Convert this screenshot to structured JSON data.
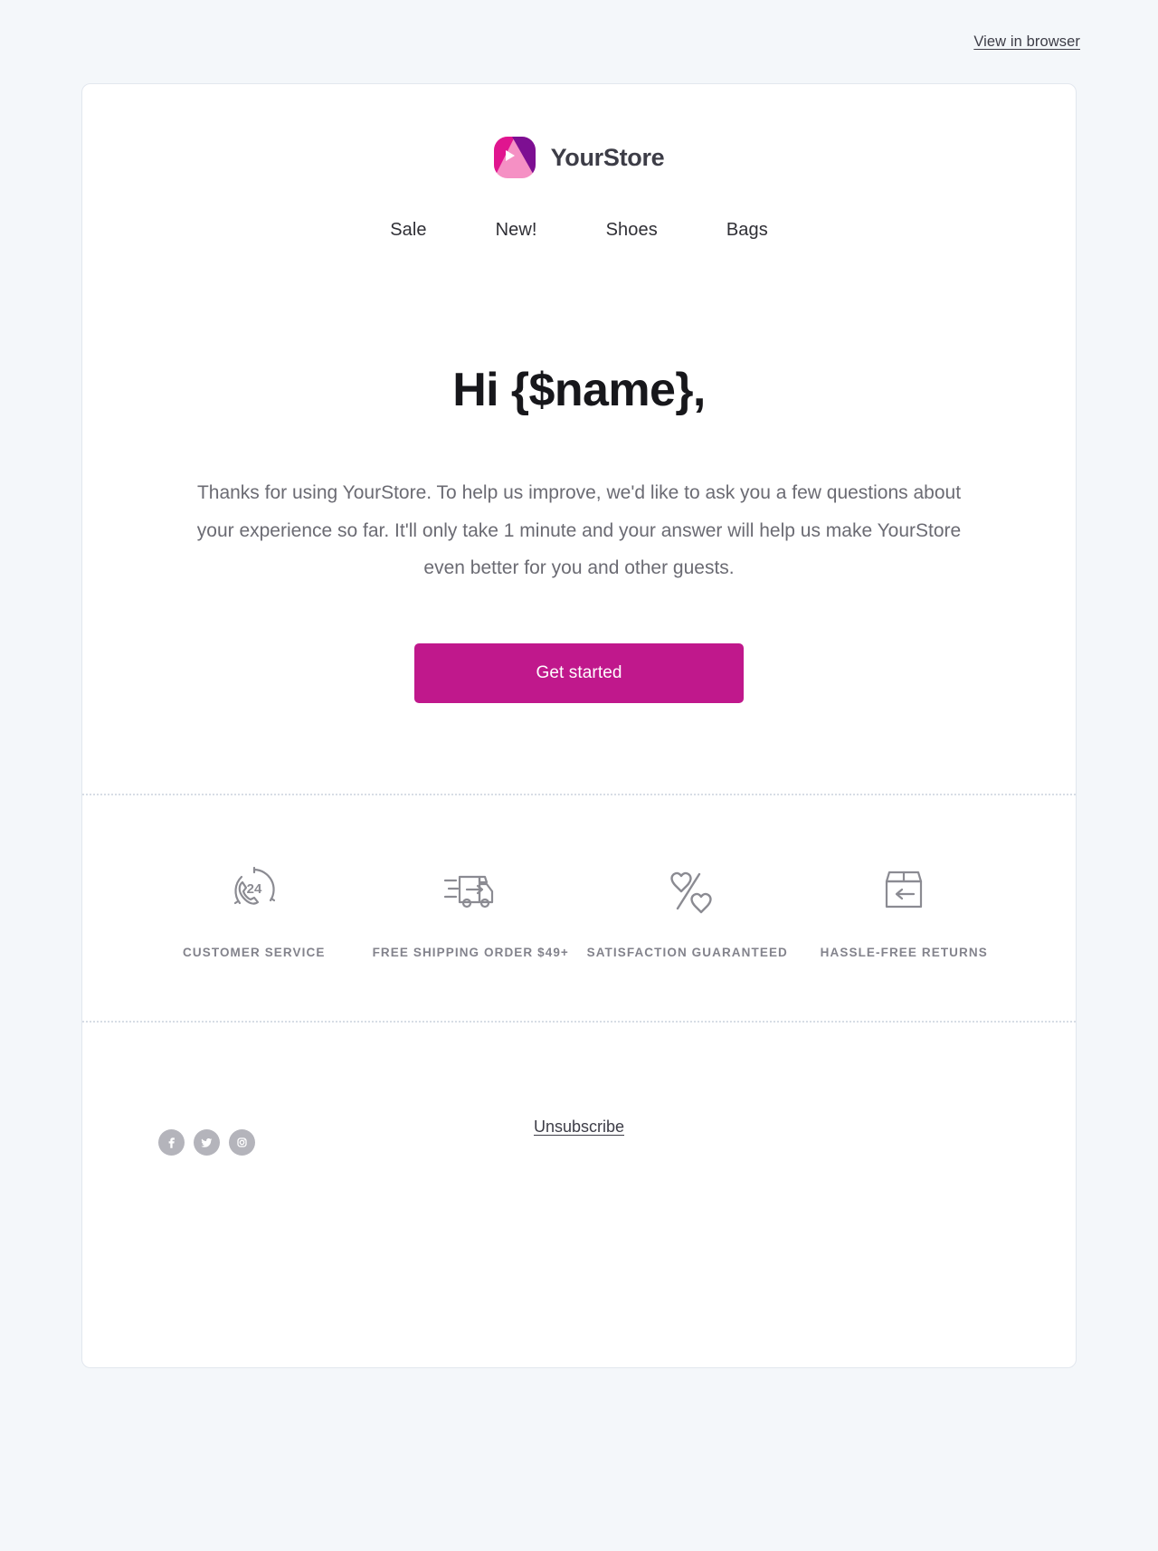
{
  "preheader": {
    "view_in_browser": "View in browser"
  },
  "brand": {
    "name": "YourStore",
    "logo_icon": "yourstore-logo-icon",
    "colors": {
      "logo_light_pink": "#f590c4",
      "logo_magenta": "#e0158f",
      "logo_purple": "#7d0f92"
    }
  },
  "nav": {
    "items": [
      {
        "label": "Sale"
      },
      {
        "label": "New!"
      },
      {
        "label": "Shoes"
      },
      {
        "label": "Bags"
      }
    ]
  },
  "hero": {
    "title": "Hi {$name},",
    "body": "Thanks for using YourStore. To help us improve, we'd like to ask you a few questions about your experience so far. It'll only take 1 minute and your answer will help us make YourStore even better for you and other guests.",
    "cta_label": "Get started",
    "cta_color": "#c0188c"
  },
  "features": [
    {
      "icon": "customer-service-24-icon",
      "label": "CUSTOMER SERVICE"
    },
    {
      "icon": "delivery-truck-icon",
      "label": "FREE SHIPPING ORDER $49+"
    },
    {
      "icon": "heart-percent-icon",
      "label": "SATISFACTION GUARANTEED"
    },
    {
      "icon": "box-return-arrow-icon",
      "label": "HASSLE-FREE RETURNS"
    }
  ],
  "footer": {
    "social": [
      {
        "icon": "facebook-icon",
        "label": "Facebook"
      },
      {
        "icon": "twitter-icon",
        "label": "Twitter"
      },
      {
        "icon": "instagram-icon",
        "label": "Instagram"
      }
    ],
    "unsubscribe": "Unsubscribe"
  }
}
